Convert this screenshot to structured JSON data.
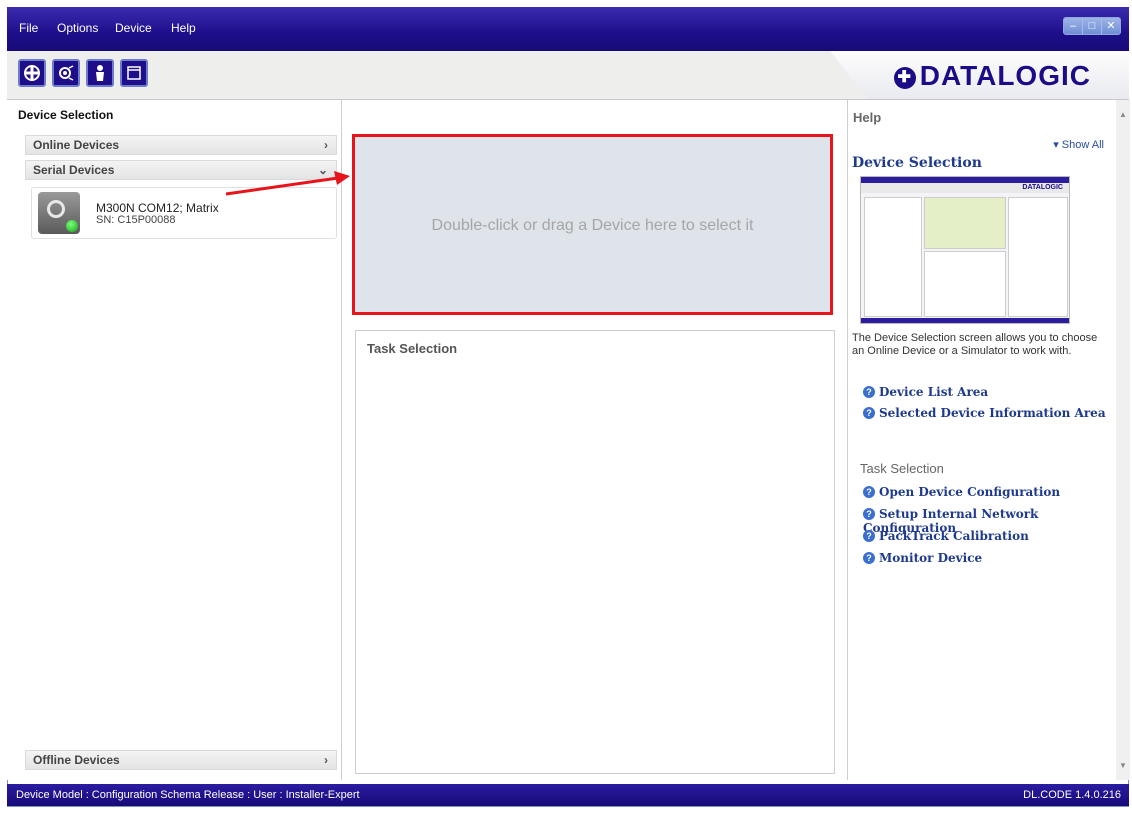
{
  "menu": {
    "items": [
      "File",
      "Options",
      "Device",
      "Help"
    ]
  },
  "window_buttons": {
    "minimize": "–",
    "restore": "□",
    "close": "✕"
  },
  "toolbar": {
    "icons": [
      "target-icon",
      "scanner-icon",
      "user-icon",
      "window-icon"
    ]
  },
  "brand": {
    "logo_text": "DATALOGIC"
  },
  "left_panel": {
    "title": "Device Selection",
    "sections": {
      "online": "Online Devices",
      "serial": "Serial Devices",
      "offline": "Offline Devices"
    },
    "device": {
      "name": "M300N COM12; Matrix",
      "serial": "SN: C15P00088"
    }
  },
  "dropzone": {
    "text": "Double-click or drag a Device here to select it"
  },
  "task_panel": {
    "title": "Task Selection"
  },
  "help": {
    "header": "Help",
    "show_all": "▾ Show All",
    "section_title": "Device Selection",
    "description": "The Device Selection screen allows you to choose an Online Device or a Simulator to work with.",
    "links": [
      "Device List Area",
      "Selected Device Information Area"
    ],
    "task_heading": "Task Selection",
    "task_links": [
      "Open Device Configuration",
      "Setup Internal Network Configuration",
      "PackTrack Calibration",
      "Monitor Device"
    ]
  },
  "status_bar": {
    "left": "Device Model :   Configuration Schema Release :    User : Installer-Expert",
    "right": "DL.CODE 1.4.0.216"
  },
  "colors": {
    "brand": "#1a0c86",
    "highlight_border": "#e8141b",
    "link": "#1e3a8c"
  }
}
